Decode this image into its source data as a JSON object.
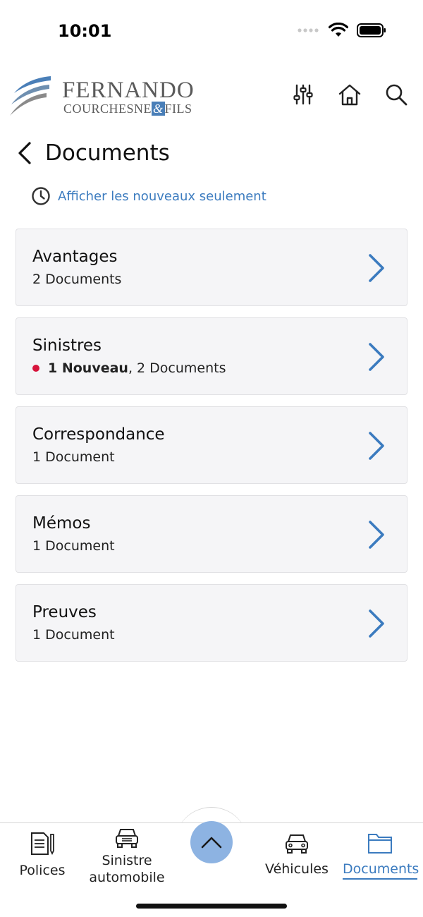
{
  "status_bar": {
    "time": "10:01"
  },
  "header": {
    "logo_line1": "FERNANDO",
    "logo_line2_a": "COURCHESNE",
    "logo_line2_amp": "&",
    "logo_line2_b": "FILS",
    "icons": [
      "sliders-icon",
      "home-icon",
      "search-icon"
    ]
  },
  "page": {
    "title": "Documents",
    "filter_link": "Afficher les nouveaux seulement"
  },
  "categories": [
    {
      "title": "Avantages",
      "new": "",
      "count": "2 Documents"
    },
    {
      "title": "Sinistres",
      "new": "1 Nouveau",
      "count": ", 2 Documents"
    },
    {
      "title": "Correspondance",
      "new": "",
      "count": "1 Document"
    },
    {
      "title": "Mémos",
      "new": "",
      "count": "1 Document"
    },
    {
      "title": "Preuves",
      "new": "",
      "count": "1 Document"
    }
  ],
  "tabbar": {
    "tabs": [
      {
        "label": "Polices",
        "icon": "document-pencil-icon"
      },
      {
        "label": "Sinistre automobile",
        "icon": "car-claim-icon"
      },
      {
        "label": "Véhicules",
        "icon": "car-icon"
      },
      {
        "label": "Documents",
        "icon": "folder-icon",
        "active": true
      }
    ]
  },
  "colors": {
    "accent": "#3b7bbf",
    "new_dot": "#d7143c",
    "card_bg": "#f5f5f7",
    "fab": "#8db3e2"
  }
}
